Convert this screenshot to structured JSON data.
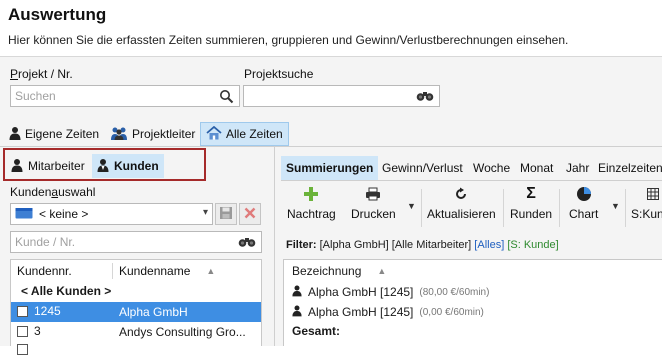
{
  "header": {
    "title": "Auswertung",
    "subtitle": "Hier können Sie die erfassten Zeiten summieren, gruppieren und Gewinn/Verlustberechnungen einsehen."
  },
  "search": {
    "project_label_pre": "P",
    "project_label_rest": "rojekt / Nr.",
    "project_placeholder": "Suchen",
    "projectsearch_label": "Projektsuche"
  },
  "main_tabs": [
    {
      "label": "Eigene Zeiten",
      "icon": "person-icon"
    },
    {
      "label": "Projektleiter",
      "icon": "people-group-icon"
    },
    {
      "label": "Alle Zeiten",
      "icon": "home-icon",
      "active": true
    }
  ],
  "sub_tabs": [
    {
      "label": "Mitarbeiter",
      "icon": "person-icon"
    },
    {
      "label": "Kunden",
      "icon": "customer-icon",
      "active": true
    }
  ],
  "customer_select": {
    "label_pre": "Kunden",
    "label_u": "a",
    "label_post": "uswahl",
    "selected": "< keine >",
    "filter_placeholder": "Kunde / Nr."
  },
  "customer_table": {
    "columns": [
      "Kundennr.",
      "Kundenname"
    ],
    "all_label": "< Alle Kunden >",
    "rows": [
      {
        "nr": "1245",
        "name": "Alpha GmbH",
        "selected": true
      },
      {
        "nr": "3",
        "name": "Andys Consulting Gro..."
      }
    ]
  },
  "right_tabs": [
    "Summierungen",
    "Gewinn/Verlust",
    "Woche",
    "Monat",
    "Jahr",
    "Einzelzeiten"
  ],
  "toolbar": {
    "nachtrag": "Nachtrag",
    "drucken": "Drucken",
    "aktualisieren": "Aktualisieren",
    "runden": "Runden",
    "chart": "Chart",
    "skunde": "S:Kun"
  },
  "filter": {
    "prefix": "Filter:",
    "text": " [Alpha GmbH] [Alle Mitarbeiter] ",
    "alles": "[Alles]",
    "s_kunde": "[S: Kunde]"
  },
  "result": {
    "column": "Bezeichnung",
    "rows": [
      {
        "name": "Alpha GmbH [1245]",
        "rate": "(80,00 €/60min)"
      },
      {
        "name": "Alpha GmbH [1245]",
        "rate": "(0,00 €/60min)"
      }
    ],
    "total": "Gesamt:"
  },
  "colors": {
    "accent_tab": "#cfe6f8",
    "selection": "#3e8ee3",
    "highlight_box": "#a52a2a",
    "link": "#1f5fbf",
    "green": "#2f8a2f"
  }
}
